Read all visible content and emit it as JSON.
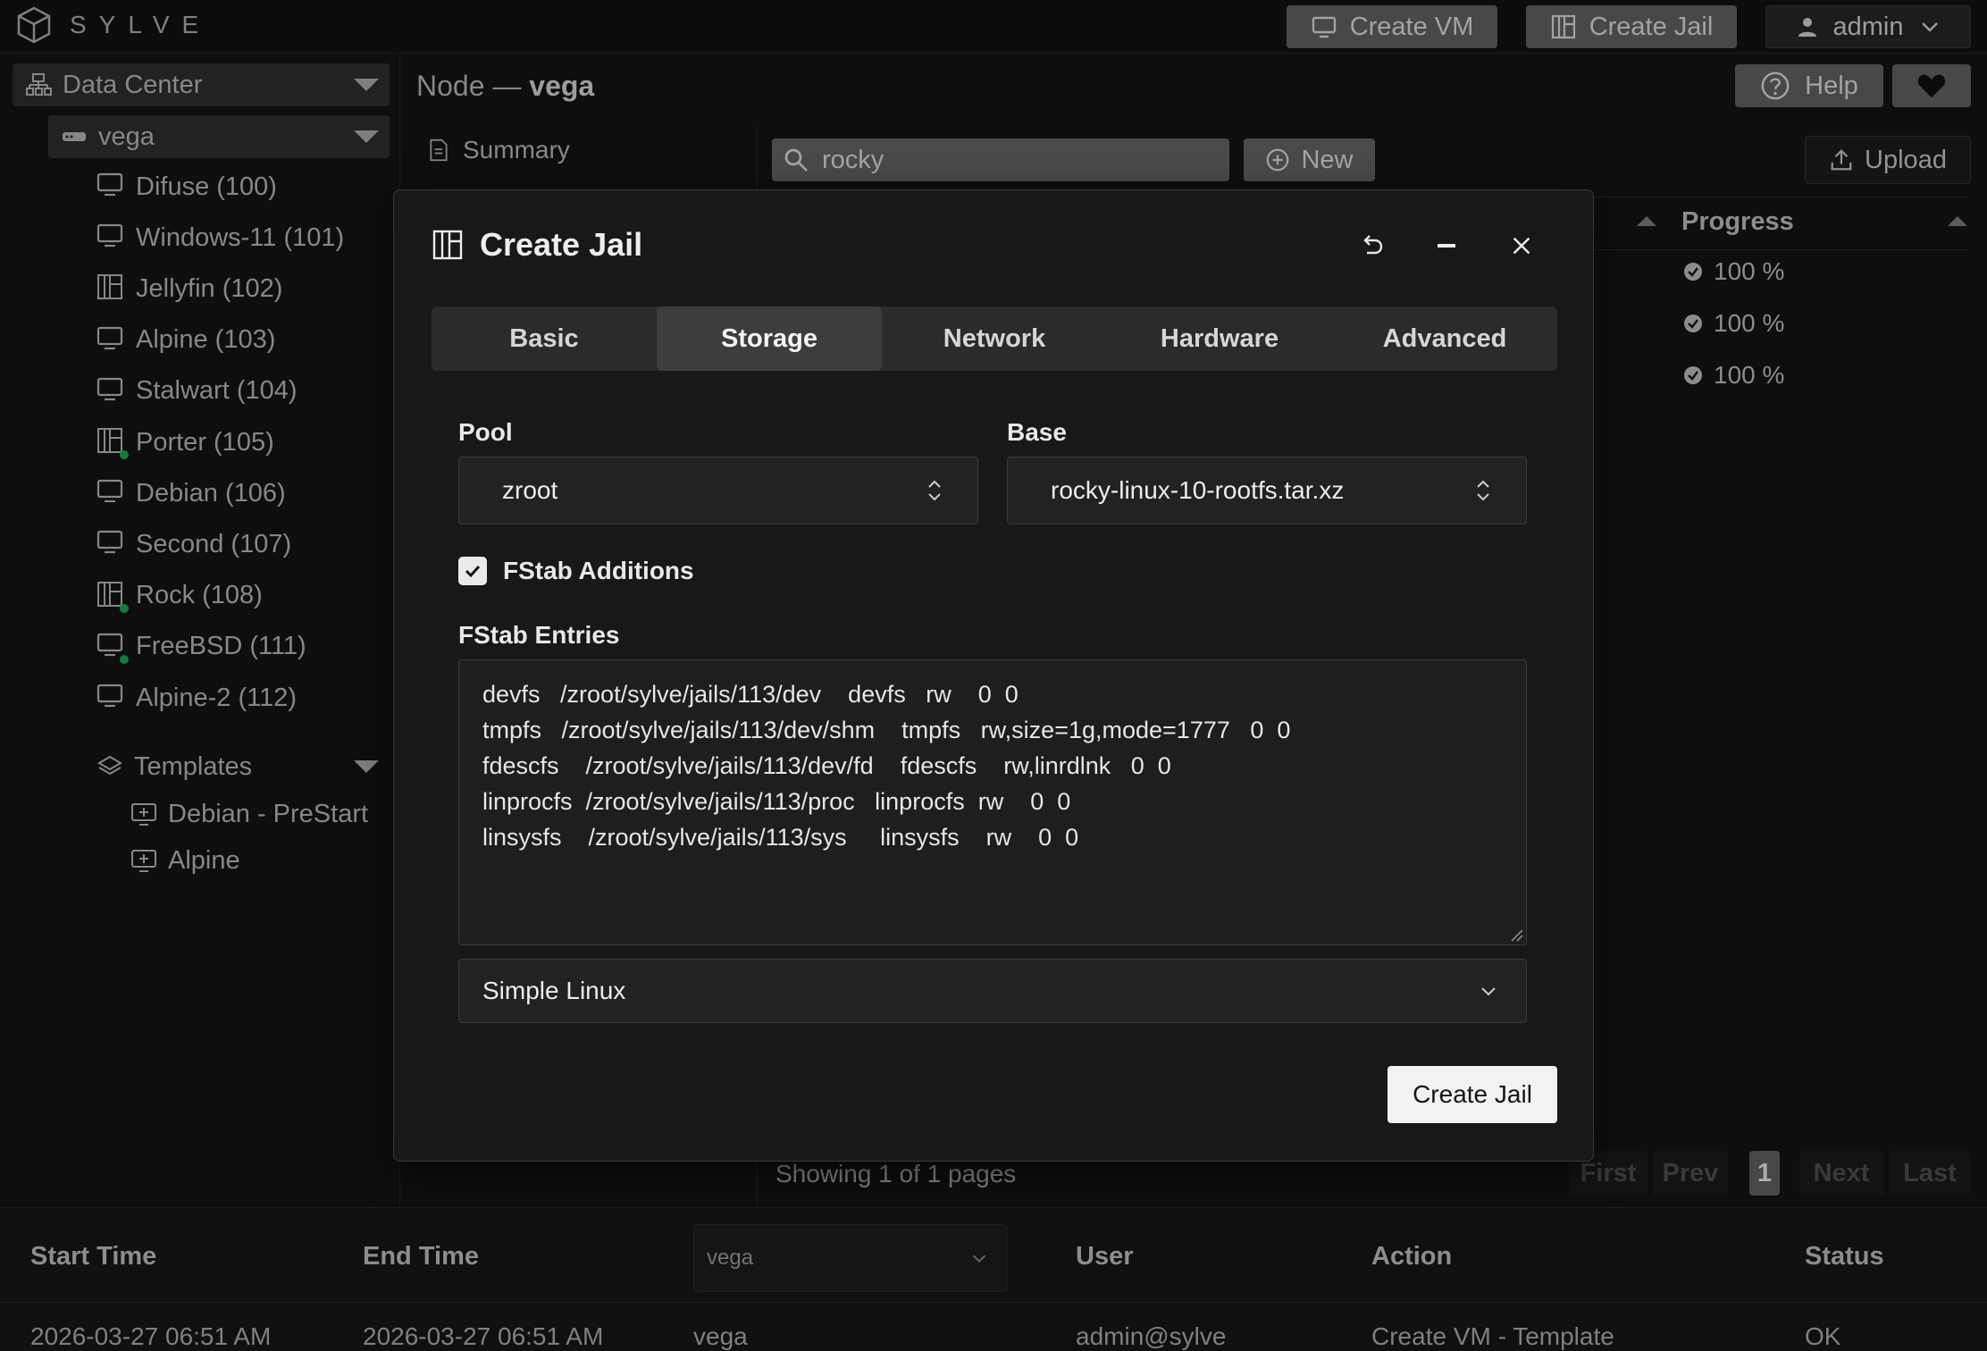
{
  "app": {
    "logo_text": "SYLVE"
  },
  "topbar": {
    "create_vm": "Create VM",
    "create_jail": "Create Jail",
    "user": "admin"
  },
  "sidebar": {
    "datacenter": "Data Center",
    "node": "vega",
    "items": [
      {
        "label": "Difuse (100)",
        "icon": "monitor-icon",
        "running": false
      },
      {
        "label": "Windows-11 (101)",
        "icon": "monitor-icon",
        "running": false
      },
      {
        "label": "Jellyfin (102)",
        "icon": "jail-icon",
        "running": false
      },
      {
        "label": "Alpine (103)",
        "icon": "monitor-icon",
        "running": false
      },
      {
        "label": "Stalwart (104)",
        "icon": "monitor-icon",
        "running": false
      },
      {
        "label": "Porter (105)",
        "icon": "jail-icon",
        "running": true
      },
      {
        "label": "Debian (106)",
        "icon": "monitor-icon",
        "running": false
      },
      {
        "label": "Second (107)",
        "icon": "monitor-icon",
        "running": false
      },
      {
        "label": "Rock (108)",
        "icon": "jail-icon",
        "running": true
      },
      {
        "label": "FreeBSD (111)",
        "icon": "monitor-icon",
        "running": true
      },
      {
        "label": "Alpine-2 (112)",
        "icon": "monitor-icon",
        "running": false
      }
    ],
    "templates_label": "Templates",
    "templates": [
      "Debian - PreStart",
      "Alpine"
    ]
  },
  "header": {
    "title_prefix": "Node — ",
    "title_node": "vega",
    "help": "Help"
  },
  "subnav": {
    "summary": "Summary"
  },
  "toolbar": {
    "search_value": "rocky",
    "new_label": "New",
    "upload_label": "Upload"
  },
  "downloads": {
    "progress_header": "Progress",
    "rows": [
      "100 %",
      "100 %",
      "100 %"
    ],
    "showing": "Showing 1 of 1 pages",
    "pager": {
      "first": "First",
      "prev": "Prev",
      "current": "1",
      "next": "Next",
      "last": "Last"
    }
  },
  "log": {
    "headers": {
      "start": "Start Time",
      "end": "End Time",
      "user": "User",
      "action": "Action",
      "status": "Status"
    },
    "node_select": "vega",
    "row": {
      "start": "2026-03-27 06:51 AM",
      "end": "2026-03-27 06:51 AM",
      "node": "vega",
      "user": "admin@sylve",
      "action": "Create VM - Template",
      "status": "OK"
    }
  },
  "modal": {
    "title": "Create Jail",
    "tabs": [
      "Basic",
      "Storage",
      "Network",
      "Hardware",
      "Advanced"
    ],
    "active_tab": "Storage",
    "pool_label": "Pool",
    "pool_value": "zroot",
    "base_label": "Base",
    "base_value": "rocky-linux-10-rootfs.tar.xz",
    "fstab_additions_label": "FStab Additions",
    "fstab_additions_checked": true,
    "fstab_entries_label": "FStab Entries",
    "fstab_lines": [
      "devfs   /zroot/sylve/jails/113/dev    devfs   rw    0  0",
      "tmpfs   /zroot/sylve/jails/113/dev/shm    tmpfs   rw,size=1g,mode=1777   0  0",
      "fdescfs    /zroot/sylve/jails/113/dev/fd    fdescfs    rw,linrdlnk   0  0",
      "linprocfs  /zroot/sylve/jails/113/proc   linprocfs  rw    0  0",
      "linsysfs    /zroot/sylve/jails/113/sys     linsysfs    rw    0  0"
    ],
    "preset_value": "Simple Linux",
    "submit_label": "Create Jail"
  },
  "colors": {
    "accent_button": "#6b6b6b",
    "running_dot": "#21b45a",
    "modal_bg": "#181818"
  }
}
